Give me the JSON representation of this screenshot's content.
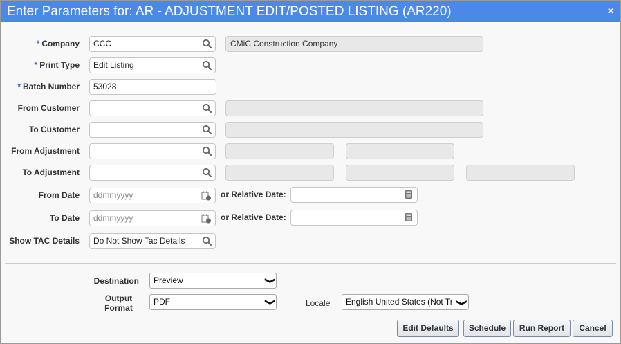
{
  "title": "Enter Parameters for: AR - ADJUSTMENT EDIT/POSTED LISTING (AR220)",
  "close": "×",
  "fields": {
    "company": {
      "label": "Company",
      "value": "CCC",
      "desc": "CMiC Construction Company"
    },
    "print_type": {
      "label": "Print Type",
      "value": "Edit Listing"
    },
    "batch_number": {
      "label": "Batch Number",
      "value": "53028"
    },
    "from_customer": {
      "label": "From Customer",
      "value": ""
    },
    "to_customer": {
      "label": "To Customer",
      "value": ""
    },
    "from_adjustment": {
      "label": "From Adjustment",
      "value": ""
    },
    "to_adjustment": {
      "label": "To Adjustment",
      "value": ""
    },
    "from_date": {
      "label": "From Date",
      "placeholder": "ddmmyyyy",
      "relative_label": "or Relative Date:"
    },
    "to_date": {
      "label": "To Date",
      "placeholder": "ddmmyyyy",
      "relative_label": "or Relative Date:"
    },
    "show_tac": {
      "label": "Show TAC Details",
      "value": "Do Not Show Tac Details"
    }
  },
  "required_mark": "*",
  "output": {
    "destination_label": "Destination",
    "destination": "Preview",
    "format_label": "Output Format",
    "format": "PDF",
    "locale_label": "Locale",
    "locale": "English United States (Not Tr:"
  },
  "buttons": {
    "edit_defaults": "Edit Defaults",
    "schedule": "Schedule",
    "run_report": "Run Report",
    "cancel": "Cancel"
  }
}
